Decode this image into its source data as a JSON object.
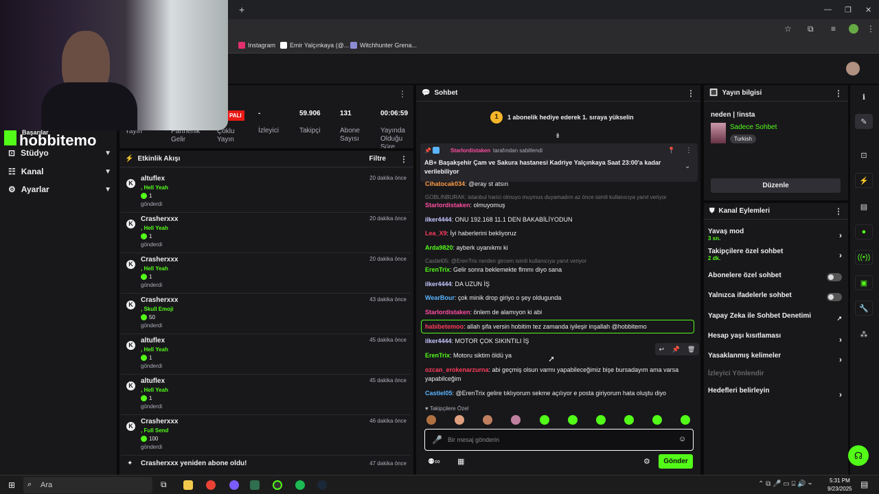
{
  "browser": {
    "bookmarks": [
      "Instagram",
      "Emir Yalçınkaya (@...",
      "Witchhunter Grena..."
    ]
  },
  "stream": {
    "badge": "PALI",
    "side_labels": [
      "Yayın",
      "Partnerlik Gelir",
      "Çoklu Yayın"
    ],
    "stats": [
      {
        "value": "-",
        "label": "İzleyici"
      },
      {
        "value": "59.906",
        "label": "Takipçi"
      },
      {
        "value": "131",
        "label": "Abone Sayısı"
      },
      {
        "value": "00:06:59",
        "label": "Yayında Olduğu Süre"
      }
    ]
  },
  "webcam": {
    "overlay": "hobbitemo",
    "overlay_sub": "Başarılar"
  },
  "sidebar": {
    "items": [
      "Stüdyo",
      "Kanal",
      "Ayarlar"
    ]
  },
  "activity": {
    "title": "Etkinlik Akışı",
    "filter": "Filtre",
    "items": [
      {
        "user": "altuflex",
        "reward": ", Hell Yeah",
        "amount": "1",
        "sent": "gönderdi",
        "time": "20 dakika önce"
      },
      {
        "user": "Crasherxxx",
        "reward": ", Hell Yeah",
        "amount": "1",
        "sent": "gönderdi",
        "time": "20 dakika önce"
      },
      {
        "user": "Crasherxxx",
        "reward": ", Hell Yeah",
        "amount": "1",
        "sent": "gönderdi",
        "time": "20 dakika önce"
      },
      {
        "user": "Crasherxxx",
        "reward": ", Skull Emoji",
        "amount": "50",
        "sent": "gönderdi",
        "time": "43 dakika önce"
      },
      {
        "user": "altuflex",
        "reward": ", Hell Yeah",
        "amount": "1",
        "sent": "gönderdi",
        "time": "45 dakika önce"
      },
      {
        "user": "altuflex",
        "reward": ", Hell Yeah",
        "amount": "1",
        "sent": "gönderdi",
        "time": "45 dakika önce"
      },
      {
        "user": "Crasherxxx",
        "reward": ", Full Send",
        "amount": "100",
        "sent": "gönderdi",
        "time": "46 dakika önce"
      }
    ],
    "last": {
      "text": "Crasherxxx yeniden abone oldu!",
      "time": "47 dakika önce"
    }
  },
  "chat": {
    "title": "Sohbet",
    "gift_banner": "1 abonelik hediye ederek 1. sıraya yükselin",
    "gift_rank": "1",
    "pinned_by_user": "Starlordistaken",
    "pinned_by_suffix": "tarafından sabitlendi",
    "pinned_text": "AB+ Başakşehir Çam ve Sakura hastanesi Kadriye Yalçınkaya Saat 23:00'a kadar verilebiliyor",
    "reply_1": "GOBLINBURAK: istanbul harici olmuyo muymus duyamadım az önce isimli kullanıcıya yanıt veriyor",
    "reply_2": "Castiel05: @ErenTrix nerden gircem isimli kullanıcıya yanıt veriyor",
    "followers_only": "Takipçilere Özel",
    "input_placeholder": "Bir mesaj gönderin",
    "send": "Gönder",
    "messages": [
      {
        "user": "Cihatocak034",
        "text": ": @eray st atsın",
        "color": "#ff9f4a"
      },
      {
        "user": "Starlordistaken",
        "text": ": olmuyomuş",
        "color": "#ff4ea1"
      },
      {
        "user": "ilker4444",
        "text": ": ONU 192.168 11.1 DEN BAKABİLİYODUN",
        "color": "#c7c7ff"
      },
      {
        "user": "Lea_X9",
        "text": ": İyi haberlerini bekliyoruz",
        "color": "#ff3b5c"
      },
      {
        "user": "Arda9820",
        "text": ": ayberk uyanıkmı ki",
        "color": "#53fc18"
      },
      {
        "user": "ErenTrix",
        "text": ": Gelir sonra beklemekte flmmı diyo sana",
        "color": "#53fc18"
      },
      {
        "user": "ilker4444",
        "text": ": DA UZUN İŞ",
        "color": "#c7c7ff"
      },
      {
        "user": "WearBour",
        "text": ": çok minik drop giriyo o şey oldugunda",
        "color": "#5ab4ff"
      },
      {
        "user": "Starlordistaken",
        "text": ": önlem de alamıyon ki abi",
        "color": "#ff4ea1"
      },
      {
        "user": "habibetemoo",
        "text": ": allah şifa versin hobitim tez zamanda iyileşir inşallah @hobbitemo",
        "color": "#ff3b5c"
      },
      {
        "user": "ilker4444",
        "text": ": MOTOR ÇOK SIKINTILI İŞ",
        "color": "#c7c7ff"
      },
      {
        "user": "ErenTrix",
        "text": ": Motoru siktim öldü ya",
        "color": "#53fc18"
      },
      {
        "user": "ozcan_erokenarzurna",
        "text": ": abi geçmiş olsun varmı yapabileceğimiz bişe bursadayım ama varsa yapabilceğim",
        "color": "#ff3b5c"
      },
      {
        "user": "Castiel05",
        "text": ": @ErenTrix gelire tıklıyorum sekme açılıyor e posta giriyorum hata oluştu diyo",
        "color": "#5ab4ff"
      }
    ]
  },
  "stream_info": {
    "title": "Yayın bilgisi",
    "stream_title": "neden | !insta",
    "category": "Sadece Sohbet",
    "tag": "Turkish",
    "edit": "Düzenle"
  },
  "channel_actions": {
    "title": "Kanal Eylemleri",
    "rows": [
      {
        "label": "Yavaş mod",
        "sub": "3 sn."
      },
      {
        "label": "Takipçilere özel sohbet",
        "sub": "2 dk."
      },
      {
        "label": "Abonelere özel sohbet",
        "sub": ""
      },
      {
        "label": "Yalnızca ifadelerle sohbet",
        "sub": ""
      },
      {
        "label": "Yapay Zeka ile Sohbet Denetimi",
        "sub": ""
      },
      {
        "label": "Hesap yaşı kısıtlaması",
        "sub": ""
      },
      {
        "label": "Yasaklanmış kelimeler",
        "sub": ""
      },
      {
        "label": "İzleyici Yönlendir",
        "sub": ""
      },
      {
        "label": "Hedefleri belirleyin",
        "sub": ""
      }
    ]
  },
  "taskbar": {
    "search": "Ara",
    "time": "5:31 PM",
    "date": "9/23/2025"
  },
  "colors": {
    "accent": "#53fc18",
    "panel": "#18181b"
  }
}
